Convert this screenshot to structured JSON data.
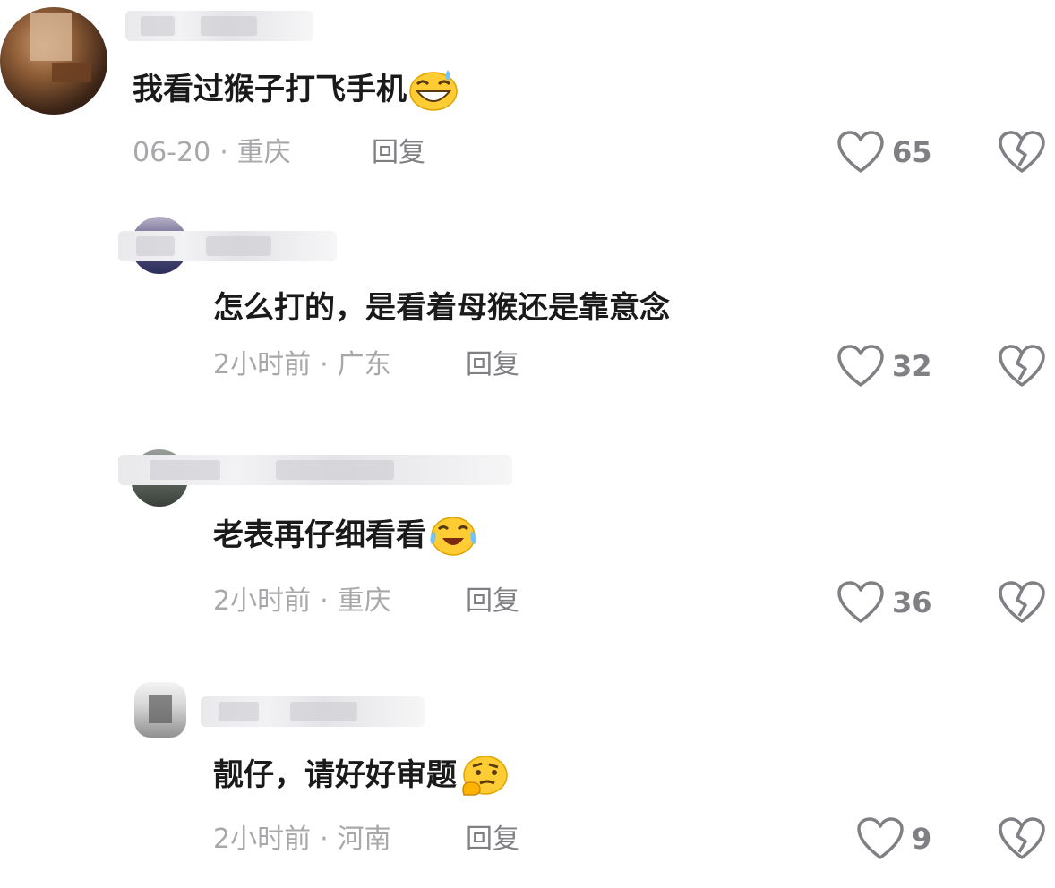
{
  "comments": [
    {
      "text": "我看过猴子打飞手机",
      "emoji": "grinning-sweat-emoji",
      "date": "06-20",
      "location": "重庆",
      "reply_label": "回复",
      "likes": "65"
    },
    {
      "text": "怎么打的，是看着母猴还是靠意念",
      "emoji": "",
      "date": "2小时前",
      "location": "广东",
      "reply_label": "回复",
      "likes": "32"
    },
    {
      "text": "老表再仔细看看",
      "emoji": "tears-of-joy-emoji",
      "date": "2小时前",
      "location": "重庆",
      "reply_label": "回复",
      "likes": "36"
    },
    {
      "text": "靓仔，请好好审题",
      "emoji": "thinking-emoji",
      "date": "2小时前",
      "location": "河南",
      "reply_label": "回复",
      "likes": "9"
    }
  ],
  "separator": "·",
  "icons": {
    "like": "heart-outline-icon",
    "dislike": "broken-heart-icon"
  },
  "colors": {
    "text": "#1a1a1a",
    "meta": "#a8a8ab",
    "action": "#7f7f84",
    "emoji_face": "#ffcc33"
  }
}
